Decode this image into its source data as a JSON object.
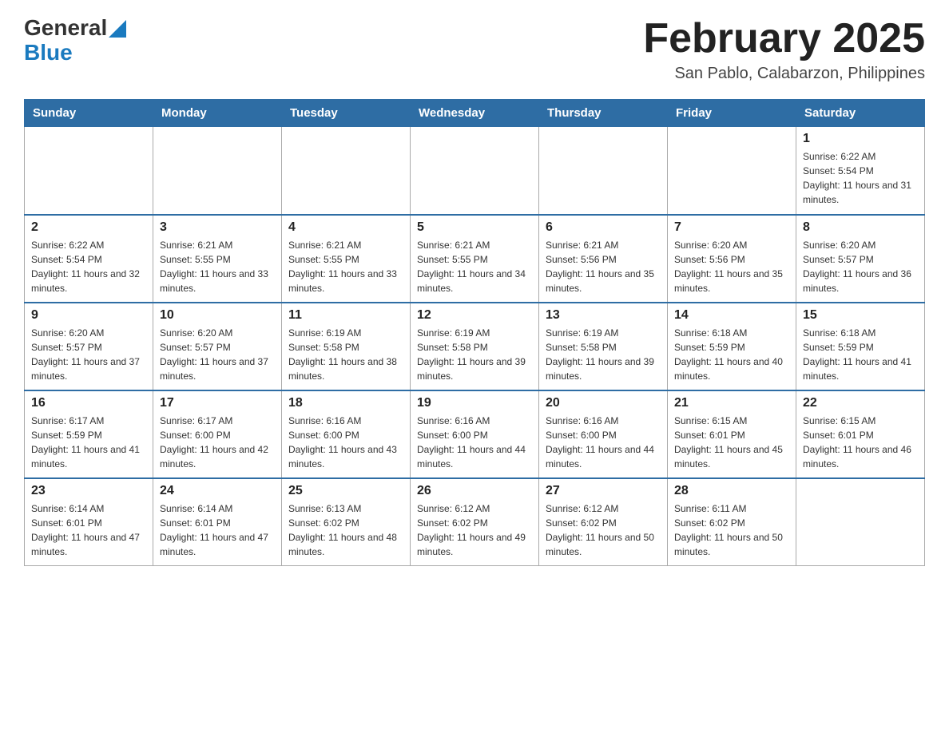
{
  "header": {
    "logo_general": "General",
    "logo_blue": "Blue",
    "month_title": "February 2025",
    "location": "San Pablo, Calabarzon, Philippines"
  },
  "days_of_week": [
    "Sunday",
    "Monday",
    "Tuesday",
    "Wednesday",
    "Thursday",
    "Friday",
    "Saturday"
  ],
  "weeks": [
    {
      "days": [
        {
          "number": "",
          "sunrise": "",
          "sunset": "",
          "daylight": ""
        },
        {
          "number": "",
          "sunrise": "",
          "sunset": "",
          "daylight": ""
        },
        {
          "number": "",
          "sunrise": "",
          "sunset": "",
          "daylight": ""
        },
        {
          "number": "",
          "sunrise": "",
          "sunset": "",
          "daylight": ""
        },
        {
          "number": "",
          "sunrise": "",
          "sunset": "",
          "daylight": ""
        },
        {
          "number": "",
          "sunrise": "",
          "sunset": "",
          "daylight": ""
        },
        {
          "number": "1",
          "sunrise": "Sunrise: 6:22 AM",
          "sunset": "Sunset: 5:54 PM",
          "daylight": "Daylight: 11 hours and 31 minutes."
        }
      ]
    },
    {
      "days": [
        {
          "number": "2",
          "sunrise": "Sunrise: 6:22 AM",
          "sunset": "Sunset: 5:54 PM",
          "daylight": "Daylight: 11 hours and 32 minutes."
        },
        {
          "number": "3",
          "sunrise": "Sunrise: 6:21 AM",
          "sunset": "Sunset: 5:55 PM",
          "daylight": "Daylight: 11 hours and 33 minutes."
        },
        {
          "number": "4",
          "sunrise": "Sunrise: 6:21 AM",
          "sunset": "Sunset: 5:55 PM",
          "daylight": "Daylight: 11 hours and 33 minutes."
        },
        {
          "number": "5",
          "sunrise": "Sunrise: 6:21 AM",
          "sunset": "Sunset: 5:55 PM",
          "daylight": "Daylight: 11 hours and 34 minutes."
        },
        {
          "number": "6",
          "sunrise": "Sunrise: 6:21 AM",
          "sunset": "Sunset: 5:56 PM",
          "daylight": "Daylight: 11 hours and 35 minutes."
        },
        {
          "number": "7",
          "sunrise": "Sunrise: 6:20 AM",
          "sunset": "Sunset: 5:56 PM",
          "daylight": "Daylight: 11 hours and 35 minutes."
        },
        {
          "number": "8",
          "sunrise": "Sunrise: 6:20 AM",
          "sunset": "Sunset: 5:57 PM",
          "daylight": "Daylight: 11 hours and 36 minutes."
        }
      ]
    },
    {
      "days": [
        {
          "number": "9",
          "sunrise": "Sunrise: 6:20 AM",
          "sunset": "Sunset: 5:57 PM",
          "daylight": "Daylight: 11 hours and 37 minutes."
        },
        {
          "number": "10",
          "sunrise": "Sunrise: 6:20 AM",
          "sunset": "Sunset: 5:57 PM",
          "daylight": "Daylight: 11 hours and 37 minutes."
        },
        {
          "number": "11",
          "sunrise": "Sunrise: 6:19 AM",
          "sunset": "Sunset: 5:58 PM",
          "daylight": "Daylight: 11 hours and 38 minutes."
        },
        {
          "number": "12",
          "sunrise": "Sunrise: 6:19 AM",
          "sunset": "Sunset: 5:58 PM",
          "daylight": "Daylight: 11 hours and 39 minutes."
        },
        {
          "number": "13",
          "sunrise": "Sunrise: 6:19 AM",
          "sunset": "Sunset: 5:58 PM",
          "daylight": "Daylight: 11 hours and 39 minutes."
        },
        {
          "number": "14",
          "sunrise": "Sunrise: 6:18 AM",
          "sunset": "Sunset: 5:59 PM",
          "daylight": "Daylight: 11 hours and 40 minutes."
        },
        {
          "number": "15",
          "sunrise": "Sunrise: 6:18 AM",
          "sunset": "Sunset: 5:59 PM",
          "daylight": "Daylight: 11 hours and 41 minutes."
        }
      ]
    },
    {
      "days": [
        {
          "number": "16",
          "sunrise": "Sunrise: 6:17 AM",
          "sunset": "Sunset: 5:59 PM",
          "daylight": "Daylight: 11 hours and 41 minutes."
        },
        {
          "number": "17",
          "sunrise": "Sunrise: 6:17 AM",
          "sunset": "Sunset: 6:00 PM",
          "daylight": "Daylight: 11 hours and 42 minutes."
        },
        {
          "number": "18",
          "sunrise": "Sunrise: 6:16 AM",
          "sunset": "Sunset: 6:00 PM",
          "daylight": "Daylight: 11 hours and 43 minutes."
        },
        {
          "number": "19",
          "sunrise": "Sunrise: 6:16 AM",
          "sunset": "Sunset: 6:00 PM",
          "daylight": "Daylight: 11 hours and 44 minutes."
        },
        {
          "number": "20",
          "sunrise": "Sunrise: 6:16 AM",
          "sunset": "Sunset: 6:00 PM",
          "daylight": "Daylight: 11 hours and 44 minutes."
        },
        {
          "number": "21",
          "sunrise": "Sunrise: 6:15 AM",
          "sunset": "Sunset: 6:01 PM",
          "daylight": "Daylight: 11 hours and 45 minutes."
        },
        {
          "number": "22",
          "sunrise": "Sunrise: 6:15 AM",
          "sunset": "Sunset: 6:01 PM",
          "daylight": "Daylight: 11 hours and 46 minutes."
        }
      ]
    },
    {
      "days": [
        {
          "number": "23",
          "sunrise": "Sunrise: 6:14 AM",
          "sunset": "Sunset: 6:01 PM",
          "daylight": "Daylight: 11 hours and 47 minutes."
        },
        {
          "number": "24",
          "sunrise": "Sunrise: 6:14 AM",
          "sunset": "Sunset: 6:01 PM",
          "daylight": "Daylight: 11 hours and 47 minutes."
        },
        {
          "number": "25",
          "sunrise": "Sunrise: 6:13 AM",
          "sunset": "Sunset: 6:02 PM",
          "daylight": "Daylight: 11 hours and 48 minutes."
        },
        {
          "number": "26",
          "sunrise": "Sunrise: 6:12 AM",
          "sunset": "Sunset: 6:02 PM",
          "daylight": "Daylight: 11 hours and 49 minutes."
        },
        {
          "number": "27",
          "sunrise": "Sunrise: 6:12 AM",
          "sunset": "Sunset: 6:02 PM",
          "daylight": "Daylight: 11 hours and 50 minutes."
        },
        {
          "number": "28",
          "sunrise": "Sunrise: 6:11 AM",
          "sunset": "Sunset: 6:02 PM",
          "daylight": "Daylight: 11 hours and 50 minutes."
        },
        {
          "number": "",
          "sunrise": "",
          "sunset": "",
          "daylight": ""
        }
      ]
    }
  ]
}
